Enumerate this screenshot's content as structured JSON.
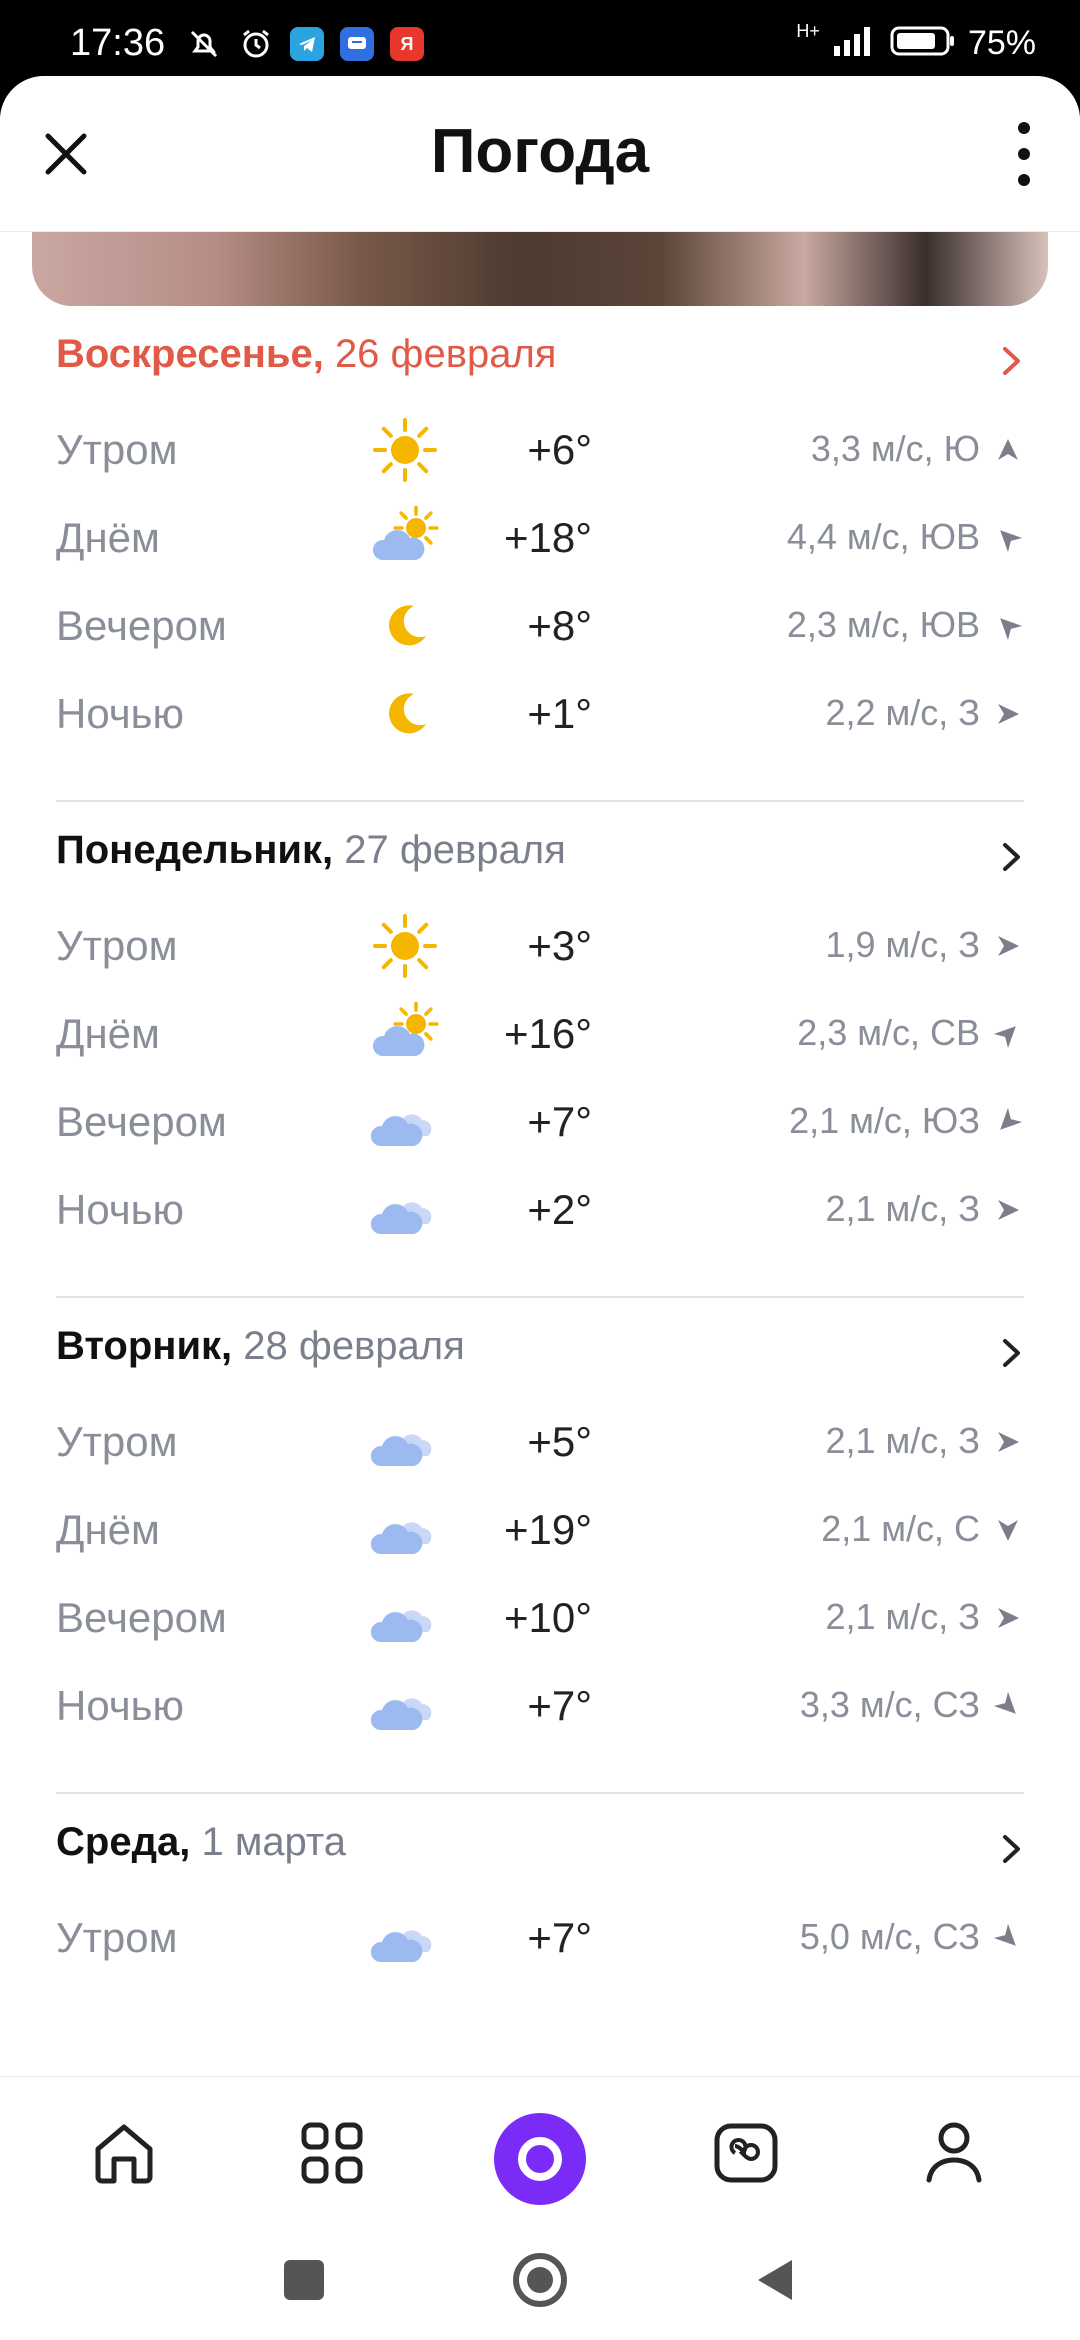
{
  "status_bar": {
    "time": "17:36",
    "battery": "75%",
    "network": "H+",
    "apps": [
      {
        "icon": "telegram-icon",
        "color": "#2aa3e0",
        "letter": ""
      },
      {
        "icon": "messages-icon",
        "color": "#2f6fe0",
        "letter": ""
      },
      {
        "icon": "yandex-icon",
        "color": "#e8382c",
        "letter": "Я"
      }
    ]
  },
  "header": {
    "title": "Погода"
  },
  "days": [
    {
      "name": "Воскресенье,",
      "date": "26 февраля",
      "today": true,
      "rows": [
        {
          "part": "Утром",
          "icon": "sun",
          "temp": "+6°",
          "wind": "3,3 м/с, Ю",
          "dir": 0
        },
        {
          "part": "Днём",
          "icon": "cloud-sun",
          "temp": "+18°",
          "wind": "4,4 м/с, ЮВ",
          "dir": -45
        },
        {
          "part": "Вечером",
          "icon": "moon",
          "temp": "+8°",
          "wind": "2,3 м/с, ЮВ",
          "dir": -45
        },
        {
          "part": "Ночью",
          "icon": "moon",
          "temp": "+1°",
          "wind": "2,2 м/с, З",
          "dir": 90
        }
      ]
    },
    {
      "name": "Понедельник,",
      "date": "27 февраля",
      "today": false,
      "rows": [
        {
          "part": "Утром",
          "icon": "sun",
          "temp": "+3°",
          "wind": "1,9 м/с, З",
          "dir": 90
        },
        {
          "part": "Днём",
          "icon": "cloud-sun",
          "temp": "+16°",
          "wind": "2,3 м/с, СВ",
          "dir": 45
        },
        {
          "part": "Вечером",
          "icon": "cloud",
          "temp": "+7°",
          "wind": "2,1 м/с, ЮЗ",
          "dir": 225
        },
        {
          "part": "Ночью",
          "icon": "cloud",
          "temp": "+2°",
          "wind": "2,1 м/с, З",
          "dir": 90
        }
      ]
    },
    {
      "name": "Вторник,",
      "date": "28 февраля",
      "today": false,
      "rows": [
        {
          "part": "Утром",
          "icon": "cloud",
          "temp": "+5°",
          "wind": "2,1 м/с, З",
          "dir": 90
        },
        {
          "part": "Днём",
          "icon": "cloud",
          "temp": "+19°",
          "wind": "2,1 м/с, С",
          "dir": 180
        },
        {
          "part": "Вечером",
          "icon": "cloud",
          "temp": "+10°",
          "wind": "2,1 м/с, З",
          "dir": 90
        },
        {
          "part": "Ночью",
          "icon": "cloud",
          "temp": "+7°",
          "wind": "3,3 м/с, СЗ",
          "dir": 135
        }
      ]
    },
    {
      "name": "Среда,",
      "date": "1 марта",
      "today": false,
      "rows": [
        {
          "part": "Утром",
          "icon": "cloud",
          "temp": "+7°",
          "wind": "5,0 м/с, СЗ",
          "dir": 135
        }
      ]
    }
  ],
  "bottom_nav": [
    "home-icon",
    "services-grid-icon",
    "alice-assistant-icon",
    "messenger-icon",
    "profile-icon"
  ],
  "colors": {
    "accent_today": "#e05a47",
    "alice": "#7b2bf6",
    "sun": "#f5b600",
    "cloud": "#9cb9f0"
  }
}
